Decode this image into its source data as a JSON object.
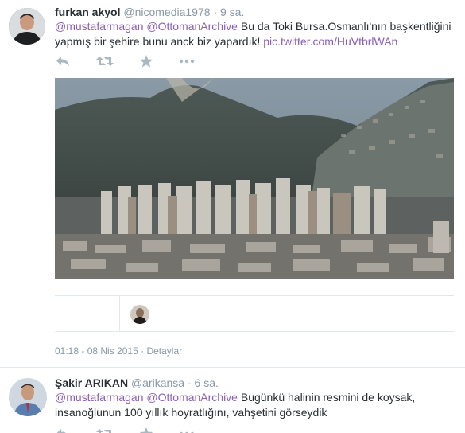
{
  "tweet1": {
    "fullname": "furkan akyol",
    "handle": "@nicomedia1978",
    "separator": "·",
    "time": "9 sa.",
    "mention1": "@mustafarmagan",
    "mention2": "@OttomanArchive",
    "text_part1": " Bu da Toki Bursa.Osmanlı'nın başkentliğini",
    "text_part2": "yapmış bir şehire bunu anck biz yapardık! ",
    "link": "pic.twitter.com/HuVtbrlWAn",
    "datetime": "01:18 - 08 Nis 2015",
    "details": "Detaylar",
    "icons": [
      "reply-icon",
      "retweet-icon",
      "favorite-icon",
      "more-icon"
    ]
  },
  "tweet2": {
    "fullname": "Şakir ARIKAN",
    "handle": "@arikansa",
    "separator": "·",
    "time": "6 sa.",
    "mention1": "@mustafarmagan",
    "mention2": "@OttomanArchive",
    "text_part1": "  Bugünkü halinin resmini de koysak,",
    "text_part2": "insanoğlunun 100 yıllık hoyratlığını, vahşetini görseydik",
    "icons": [
      "reply-icon",
      "retweet-icon",
      "favorite-icon",
      "more-icon"
    ]
  },
  "colors": {
    "link": "#8a5fb5",
    "muted": "#8899a6",
    "text": "#292f33",
    "border": "#e1e8ed"
  }
}
